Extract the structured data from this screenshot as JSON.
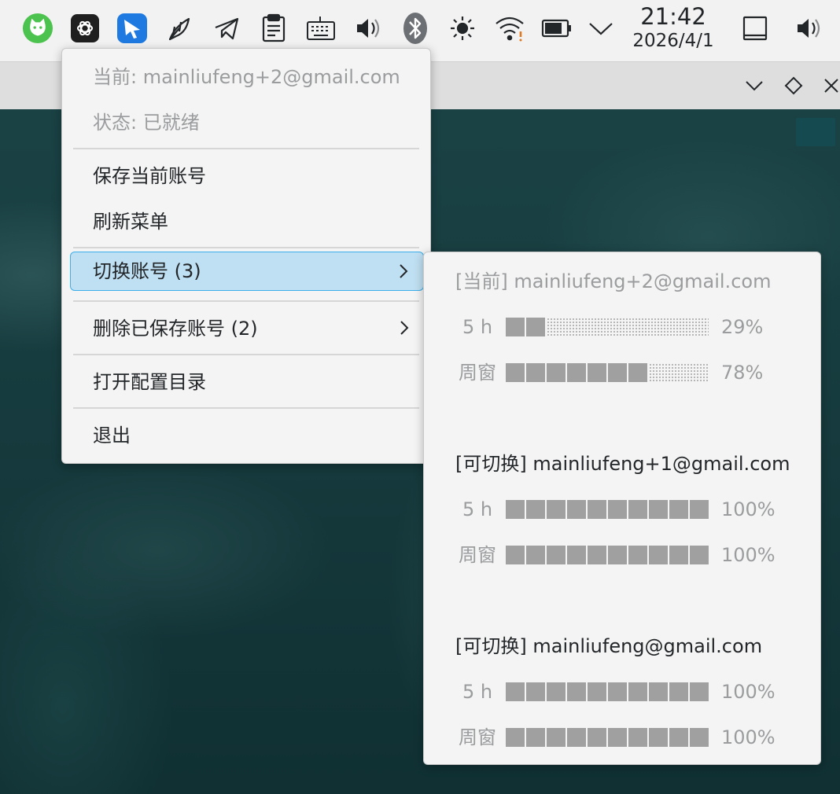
{
  "panel": {
    "clock_time": "21:42",
    "clock_date": "2026/4/1"
  },
  "main_menu": {
    "current_label": "当前: mainliufeng+2@gmail.com",
    "status_label": "状态: 已就绪",
    "save_account": "保存当前账号",
    "refresh_menu": "刷新菜单",
    "switch_account": "切换账号 (3)",
    "delete_saved": "删除已保存账号 (2)",
    "open_config_dir": "打开配置目录",
    "quit": "退出"
  },
  "accounts": [
    {
      "header": "[当前] mainliufeng+2@gmail.com",
      "state": "current",
      "usage": [
        {
          "label": "5 h",
          "percent_text": "29%",
          "filled": 2,
          "total": 10
        },
        {
          "label": "周窗",
          "percent_text": "78%",
          "filled": 7,
          "total": 10
        }
      ]
    },
    {
      "header": "[可切换] mainliufeng+1@gmail.com",
      "state": "switchable",
      "usage": [
        {
          "label": "5 h",
          "percent_text": "100%",
          "filled": 10,
          "total": 10
        },
        {
          "label": "周窗",
          "percent_text": "100%",
          "filled": 10,
          "total": 10
        }
      ]
    },
    {
      "header": "[可切换] mainliufeng@gmail.com",
      "state": "switchable",
      "usage": [
        {
          "label": "5 h",
          "percent_text": "100%",
          "filled": 10,
          "total": 10
        },
        {
          "label": "周窗",
          "percent_text": "100%",
          "filled": 10,
          "total": 10
        }
      ]
    }
  ],
  "colors": {
    "highlight_bg": "#bfe0f2",
    "highlight_border": "#3daee9",
    "usage_block": "#a0a0a0",
    "tray_cat_green": "#4cc34e",
    "tray_app_blue": "#1e7ae0"
  },
  "icons": [
    "cat-app-icon",
    "openai-icon",
    "blue-app-icon",
    "feather-icon",
    "telegram-icon",
    "clipboard-icon",
    "keyboard-icon",
    "volume-icon",
    "bluetooth-icon",
    "brightness-icon",
    "wifi-icon",
    "battery-icon",
    "chevron-down-icon",
    "show-desktop-icon"
  ]
}
